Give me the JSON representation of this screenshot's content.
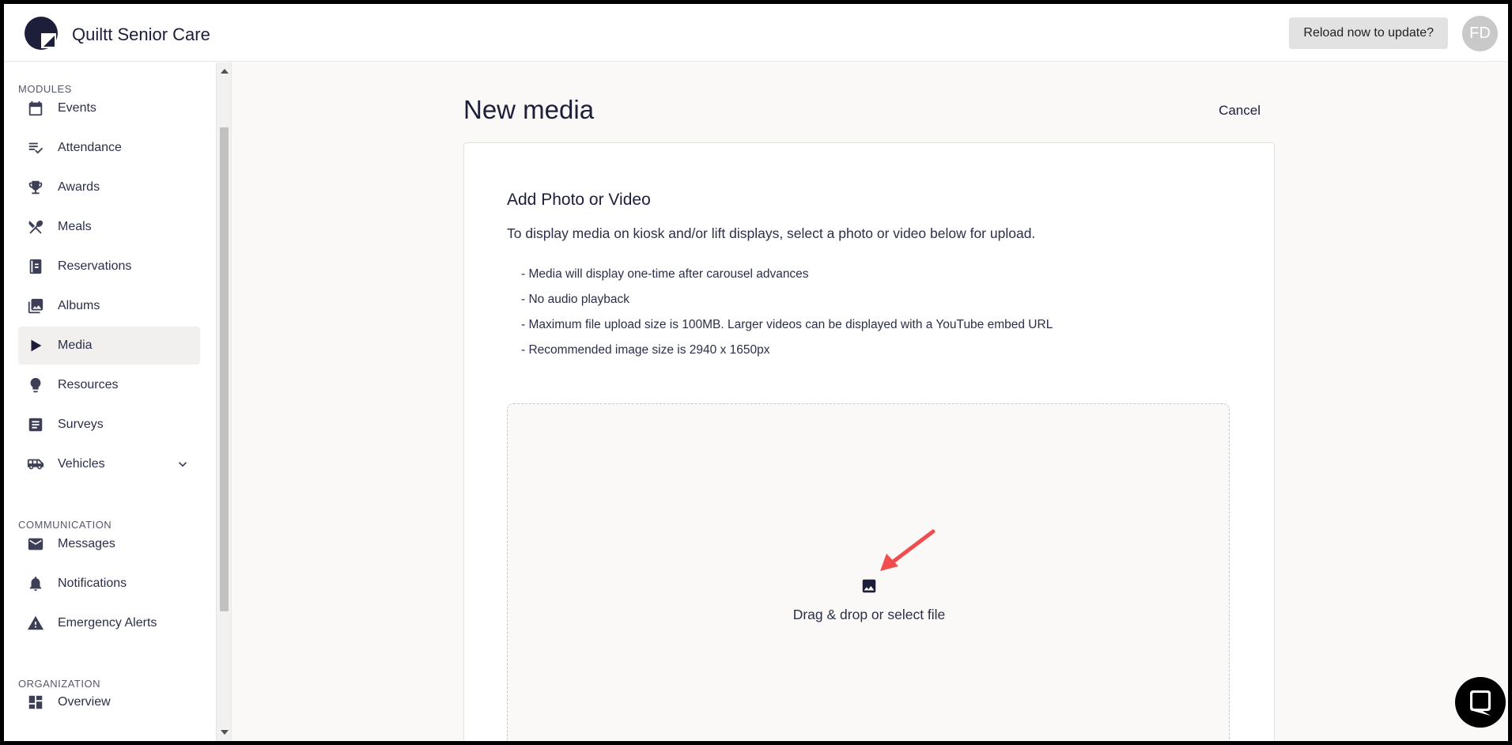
{
  "header": {
    "app_title": "Quiltt Senior Care",
    "reload_label": "Reload now to update?",
    "avatar_initials": "FD"
  },
  "sidebar": {
    "sections": [
      {
        "label": "MODULES",
        "items": [
          {
            "label": "Events",
            "icon": "calendar-icon"
          },
          {
            "label": "Attendance",
            "icon": "checklist-icon"
          },
          {
            "label": "Awards",
            "icon": "trophy-icon"
          },
          {
            "label": "Meals",
            "icon": "utensils-icon"
          },
          {
            "label": "Reservations",
            "icon": "book-icon"
          },
          {
            "label": "Albums",
            "icon": "photo-library-icon"
          },
          {
            "label": "Media",
            "icon": "play-icon",
            "active": true
          },
          {
            "label": "Resources",
            "icon": "lightbulb-icon"
          },
          {
            "label": "Surveys",
            "icon": "survey-icon"
          },
          {
            "label": "Vehicles",
            "icon": "bus-icon",
            "expandable": true
          }
        ]
      },
      {
        "label": "COMMUNICATION",
        "items": [
          {
            "label": "Messages",
            "icon": "mail-icon"
          },
          {
            "label": "Notifications",
            "icon": "bell-icon"
          },
          {
            "label": "Emergency Alerts",
            "icon": "warning-icon"
          }
        ]
      },
      {
        "label": "ORGANIZATION",
        "items": [
          {
            "label": "Overview",
            "icon": "dashboard-icon"
          }
        ]
      }
    ]
  },
  "main": {
    "page_title": "New media",
    "cancel_label": "Cancel",
    "card": {
      "title": "Add Photo or Video",
      "description": "To display media on kiosk and/or lift displays, select a photo or video below for upload.",
      "bullets": [
        "- Media will display one-time after carousel advances",
        "- No audio playback",
        "- Maximum file upload size is 100MB. Larger videos can be displayed with a YouTube embed URL",
        "- Recommended image size is 2940 x 1650px"
      ],
      "dropzone_text": "Drag & drop or select file",
      "dropzone_icon": "image-icon"
    }
  },
  "colors": {
    "brand": "#1c1e3a",
    "annotation_arrow": "#f04e4e",
    "active_nav_bg": "#f1f0ee"
  }
}
